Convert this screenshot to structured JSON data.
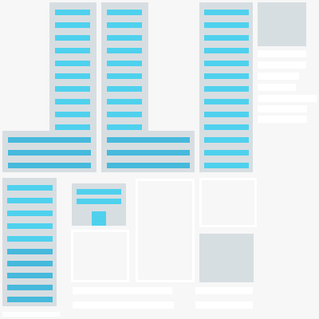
{
  "page": {
    "background": "#f7f7f7"
  },
  "colors": {
    "panel": "#d7dee2",
    "bar_light": "#4fd1ee",
    "bar_dark": "#46b9dc",
    "white": "#ffffff",
    "accent_square": "#4fd1ee"
  },
  "icons": {
    "gray_thumbnail": "gray-placeholder-square",
    "cyan_square": "cyan-square-icon"
  }
}
